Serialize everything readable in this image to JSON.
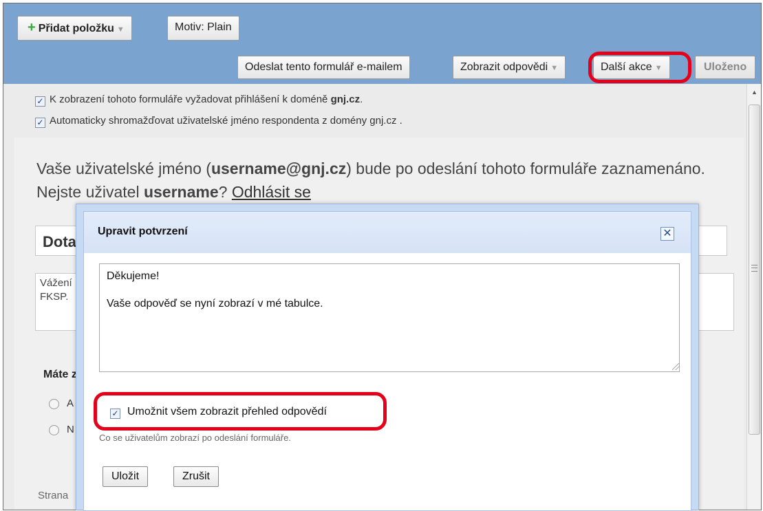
{
  "toolbar": {
    "add_item_label": "Přidat položku",
    "theme_label": "Motiv: Plain",
    "email_form_label": "Odeslat tento formulář e-mailem",
    "view_responses_label": "Zobrazit odpovědi",
    "more_actions_label": "Další akce",
    "saved_label": "Uloženo"
  },
  "settings": {
    "require_login_prefix": "K zobrazení tohoto formuláře vyžadovat přihlášení k doméně ",
    "require_login_domain": "gnj.cz",
    "require_login_suffix": ".",
    "require_login_checked": true,
    "collect_username_text": "Automaticky shromažďovat uživatelské jméno respondenta z domény gnj.cz .",
    "collect_username_checked": true
  },
  "form": {
    "note_part1": "Vaše uživatelské jméno (",
    "note_username": "username@gnj.cz",
    "note_part2": ") bude po odeslání tohoto formuláře zaznamenáno. Nejste uživatel ",
    "note_user": "username",
    "note_part3": "? ",
    "logout_link": "Odhlásit se",
    "title_visible": "Dota",
    "description_line1": "Vážení",
    "description_line2": "FKSP.",
    "question_visible": "Máte z",
    "option_yes_visible": "A",
    "option_no_visible": "N",
    "page_label_visible": "Strana"
  },
  "dialog": {
    "title": "Upravit potvrzení",
    "close_symbol": "✕",
    "confirmation_text": "Děkujeme!\n\nVaše odpověď se nyní zobrazí v mé tabulce.",
    "share_label": "Umožnit všem zobrazit přehled odpovědí",
    "share_checked": true,
    "hint": "Co se uživatelům zobrazí po odeslání formuláře.",
    "save_label": "Uložit",
    "cancel_label": "Zrušit"
  },
  "colors": {
    "toolbar_bg": "#7aa4cf",
    "highlight": "#e3001b",
    "dialog_border": "#c6daf4"
  }
}
